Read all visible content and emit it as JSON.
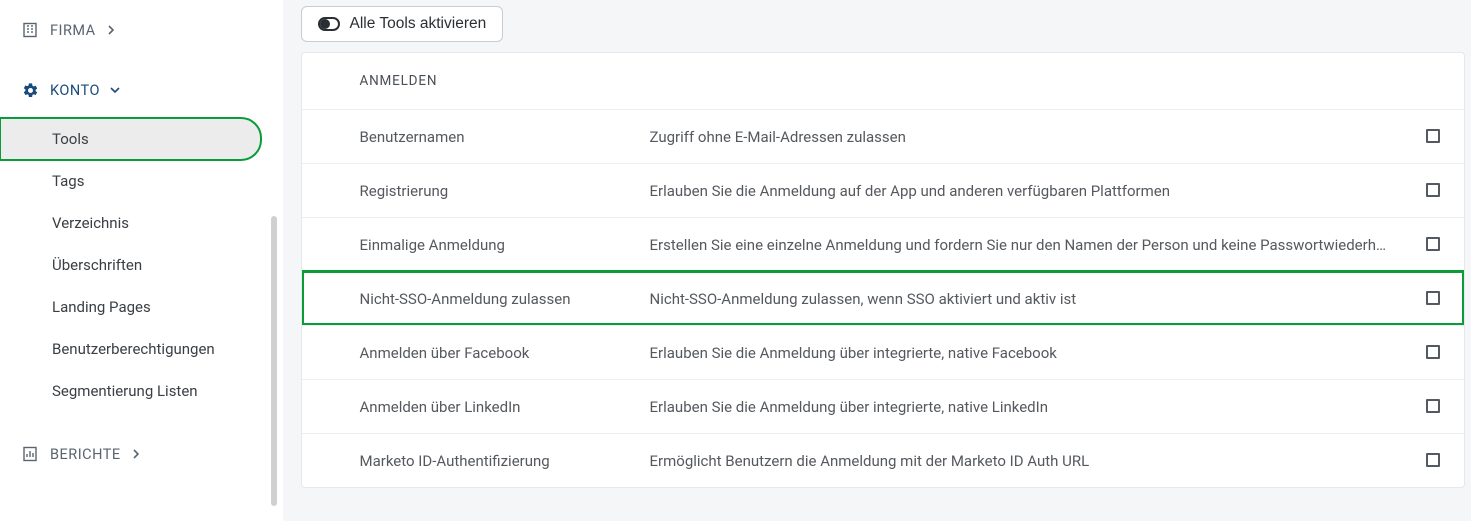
{
  "sidebar": {
    "firma": {
      "label": "FIRMA"
    },
    "konto": {
      "label": "KONTO",
      "items": [
        {
          "label": "Tools",
          "active": true,
          "highlighted": true
        },
        {
          "label": "Tags"
        },
        {
          "label": "Verzeichnis"
        },
        {
          "label": "Überschriften"
        },
        {
          "label": "Landing Pages"
        },
        {
          "label": "Benutzerberechtigungen"
        },
        {
          "label": "Segmentierung Listen"
        }
      ]
    },
    "berichte": {
      "label": "BERICHTE"
    }
  },
  "toolbar": {
    "activate_all_label": "Alle Tools aktivieren"
  },
  "panel": {
    "header": "ANMELDEN",
    "rows": [
      {
        "name": "Benutzernamen",
        "desc": "Zugriff ohne E-Mail-Adressen zulassen"
      },
      {
        "name": "Registrierung",
        "desc": "Erlauben Sie die Anmeldung auf der App und anderen verfügbaren Plattformen"
      },
      {
        "name": "Einmalige Anmeldung",
        "desc": "Erstellen Sie eine einzelne Anmeldung und fordern Sie nur den Namen der Person und keine Passwortwiederh…"
      },
      {
        "name": "Nicht-SSO-Anmeldung zulassen",
        "desc": "Nicht-SSO-Anmeldung zulassen, wenn SSO aktiviert und aktiv ist",
        "highlighted": true
      },
      {
        "name": "Anmelden über Facebook",
        "desc": "Erlauben Sie die Anmeldung über integrierte, native Facebook"
      },
      {
        "name": "Anmelden über LinkedIn",
        "desc": "Erlauben Sie die Anmeldung über integrierte, native LinkedIn"
      },
      {
        "name": "Marketo ID-Authentifizierung",
        "desc": "Ermöglicht Benutzern die Anmeldung mit der Marketo ID Auth URL"
      }
    ]
  }
}
